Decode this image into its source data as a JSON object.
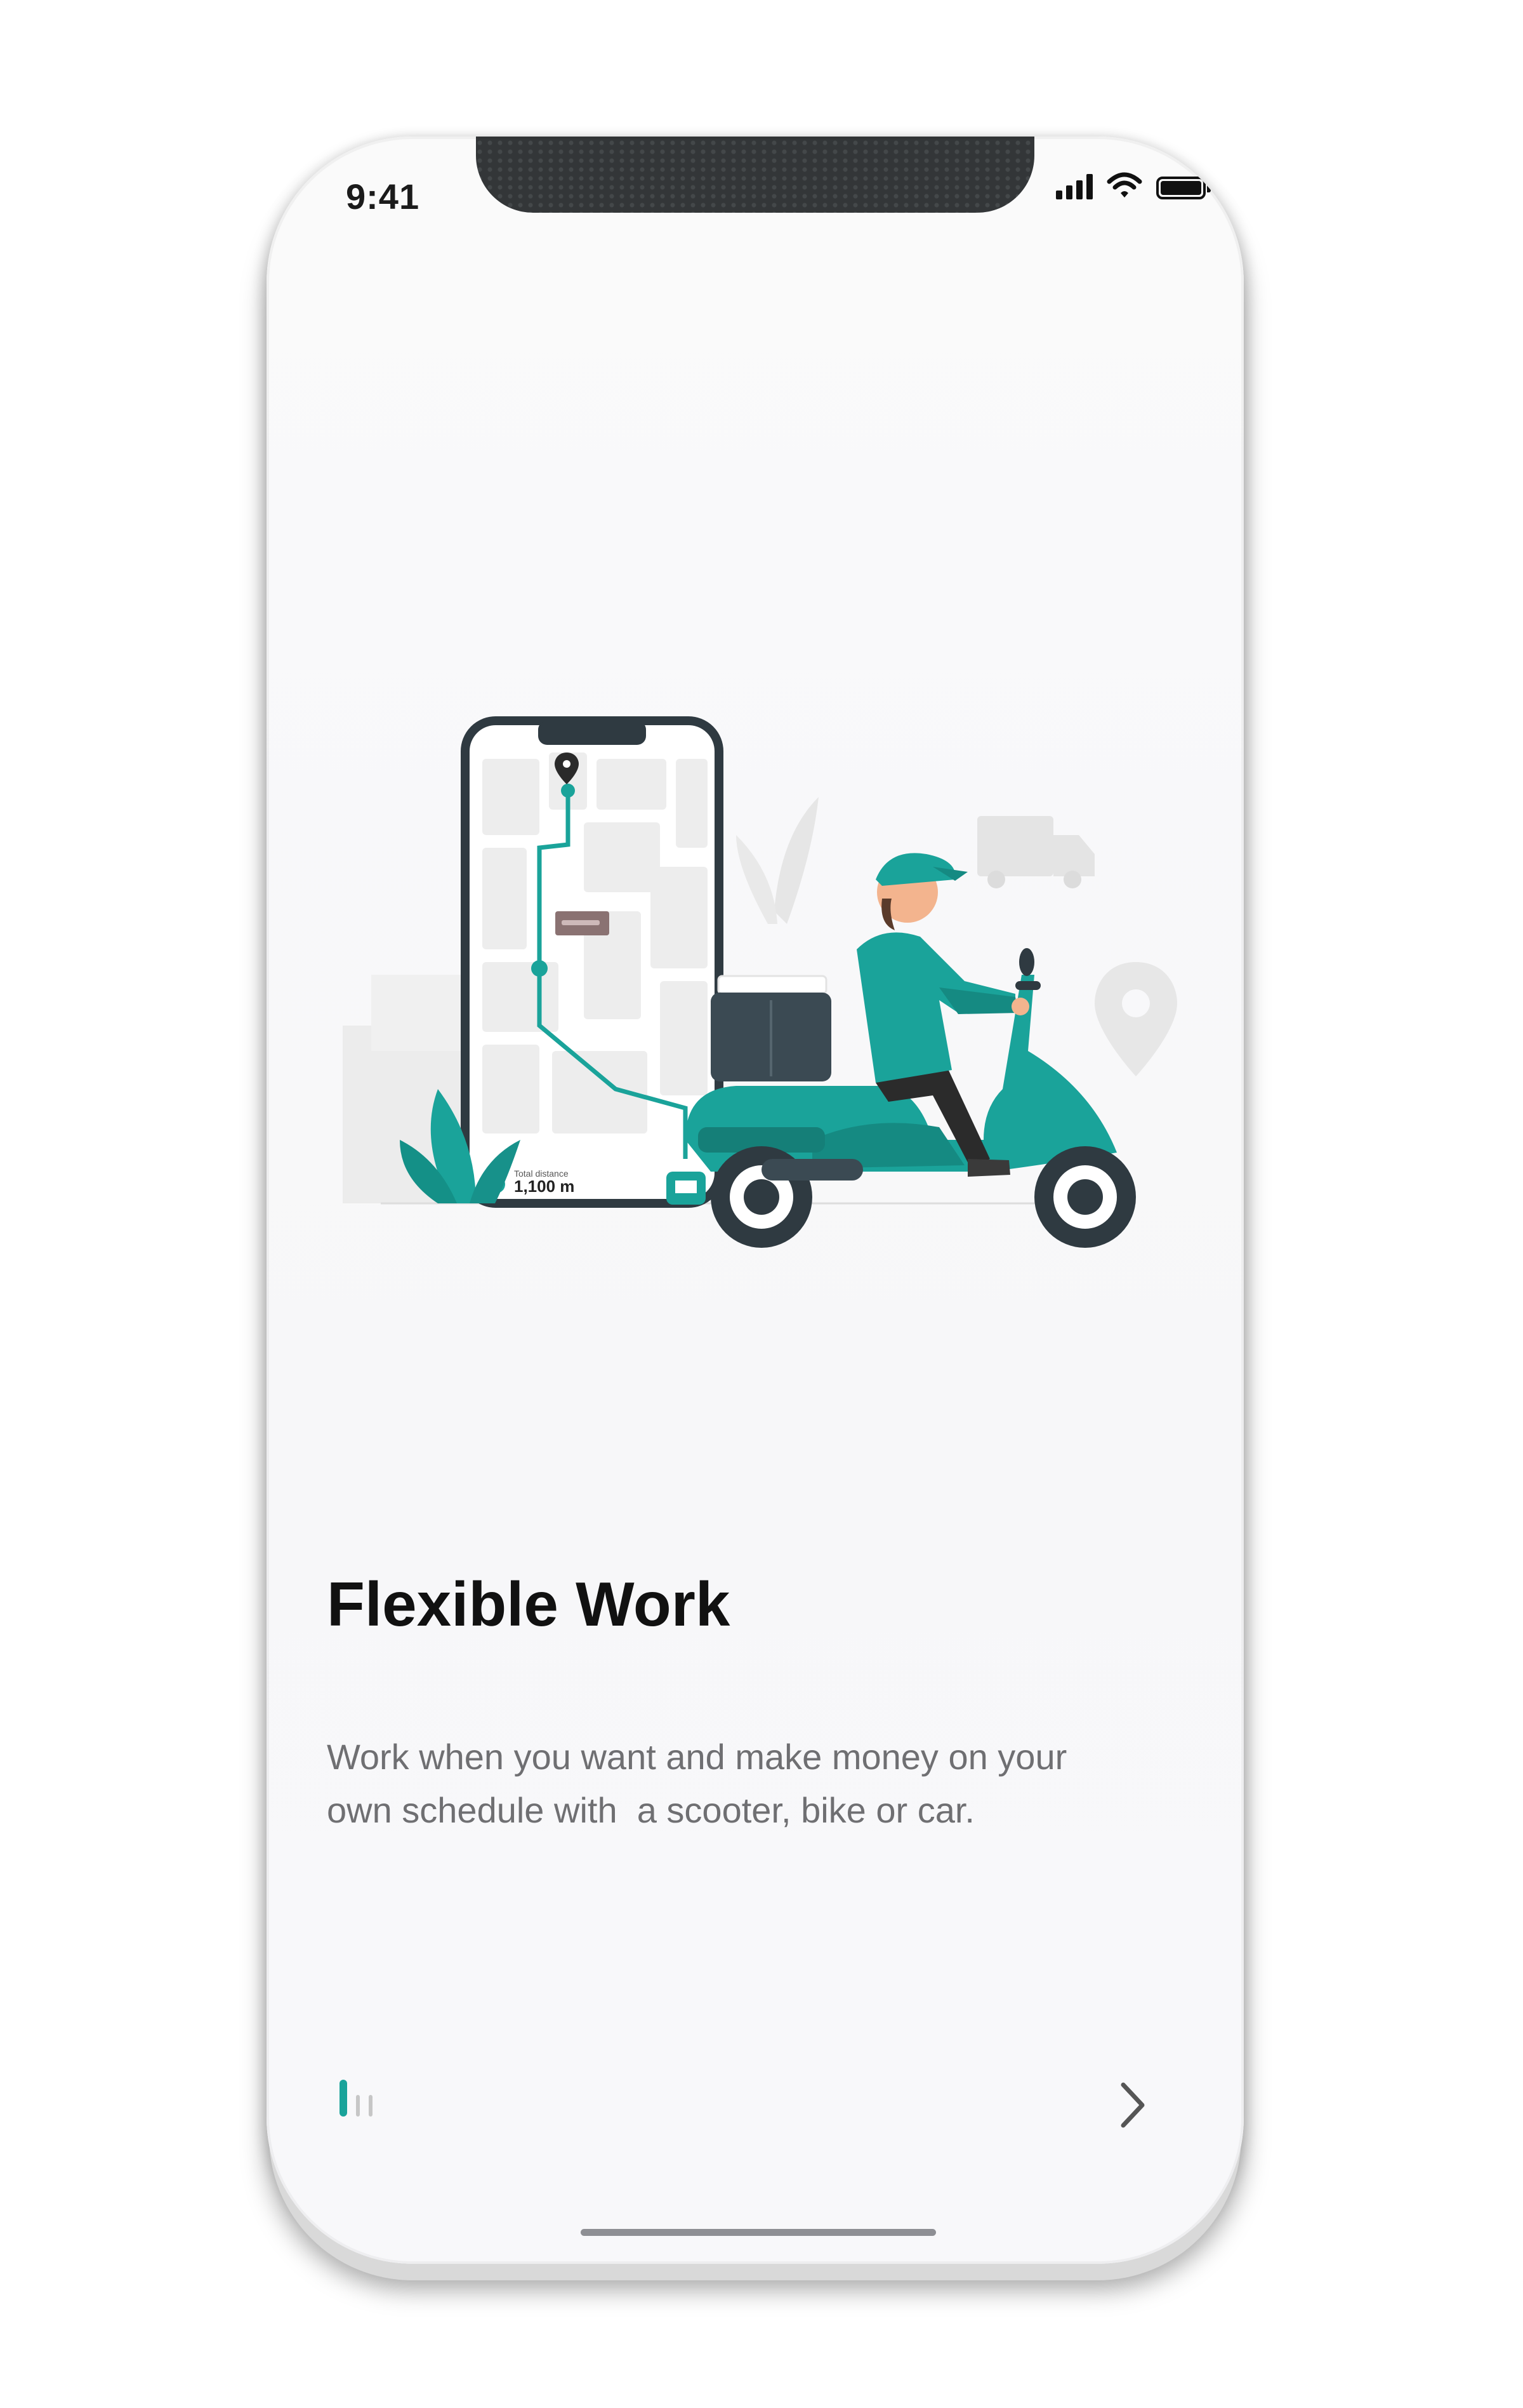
{
  "status_bar": {
    "time": "9:41",
    "icons": [
      "cellular-signal-icon",
      "wifi-icon",
      "battery-icon"
    ]
  },
  "onboarding": {
    "title": "Flexible Work",
    "description": "Work when you want and make money on your\nown schedule with  a scooter, bike or car.",
    "pager": {
      "current_page": 1,
      "total_pages": 3
    }
  },
  "illustration": {
    "name": "delivery-scooter-illustration",
    "map_label": "1,100 m",
    "map_caption": "Total distance"
  },
  "colors": {
    "accent": "#1aa39a",
    "text_primary": "#111111",
    "text_secondary": "#6f6f72",
    "background": "#f8f8fa"
  }
}
